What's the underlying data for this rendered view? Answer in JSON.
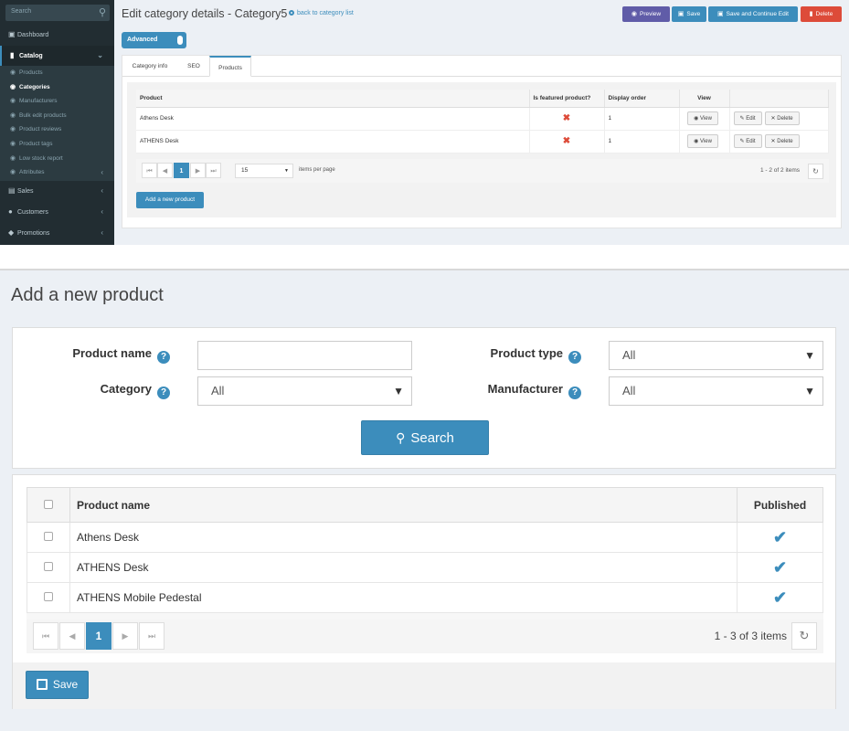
{
  "top": {
    "sidebar": {
      "search_placeholder": "Search",
      "items": [
        {
          "label": "Dashboard",
          "icon": "monitor-icon"
        },
        {
          "label": "Catalog",
          "icon": "book-icon"
        },
        {
          "label": "Sales",
          "icon": "cart-icon"
        },
        {
          "label": "Customers",
          "icon": "user-icon"
        },
        {
          "label": "Promotions",
          "icon": "tag-icon"
        }
      ],
      "catalog_sub": [
        {
          "label": "Products"
        },
        {
          "label": "Categories",
          "active": true
        },
        {
          "label": "Manufacturers"
        },
        {
          "label": "Bulk edit products"
        },
        {
          "label": "Product reviews"
        },
        {
          "label": "Product tags"
        },
        {
          "label": "Low stock report"
        },
        {
          "label": "Attributes"
        }
      ]
    },
    "header": {
      "title": "Edit category details - Category5",
      "back_link": "back to category list",
      "buttons": {
        "preview": "Preview",
        "save": "Save",
        "save_continue": "Save and Continue Edit",
        "delete": "Delete"
      },
      "advanced": "Advanced"
    },
    "tabs": [
      "Category info",
      "SEO",
      "Products"
    ],
    "grid": {
      "columns": [
        "Product",
        "Is featured product?",
        "Display order",
        "View",
        ""
      ],
      "rows": [
        {
          "product": "Athens Desk",
          "featured": "✖",
          "order": "1",
          "view": "View",
          "edit": "Edit",
          "delete": "Delete"
        },
        {
          "product": "ATHENS Desk",
          "featured": "✖",
          "order": "1",
          "view": "View",
          "edit": "Edit",
          "delete": "Delete"
        }
      ],
      "pager": {
        "page": "1",
        "page_size": "15",
        "items_per_page": "items per page",
        "info": "1 - 2 of 2 items"
      }
    },
    "add_button": "Add a new product"
  },
  "bottom": {
    "title": "Add a new product",
    "form": {
      "product_name_label": "Product name",
      "product_name_value": "",
      "category_label": "Category",
      "category_value": "All",
      "product_type_label": "Product type",
      "product_type_value": "All",
      "manufacturer_label": "Manufacturer",
      "manufacturer_value": "All",
      "search_button": "Search"
    },
    "grid": {
      "columns": [
        "Product name",
        "Published"
      ],
      "rows": [
        {
          "name": "Athens Desk",
          "published": true
        },
        {
          "name": "ATHENS Desk",
          "published": true
        },
        {
          "name": "ATHENS Mobile Pedestal",
          "published": true
        }
      ],
      "pager": {
        "page": "1",
        "info": "1 - 3 of 3 items"
      }
    },
    "save_button": "Save"
  },
  "colors": {
    "primary": "#3c8dbc",
    "sidebar": "#222d32",
    "preview": "#605ca8",
    "danger": "#dd4b39"
  }
}
